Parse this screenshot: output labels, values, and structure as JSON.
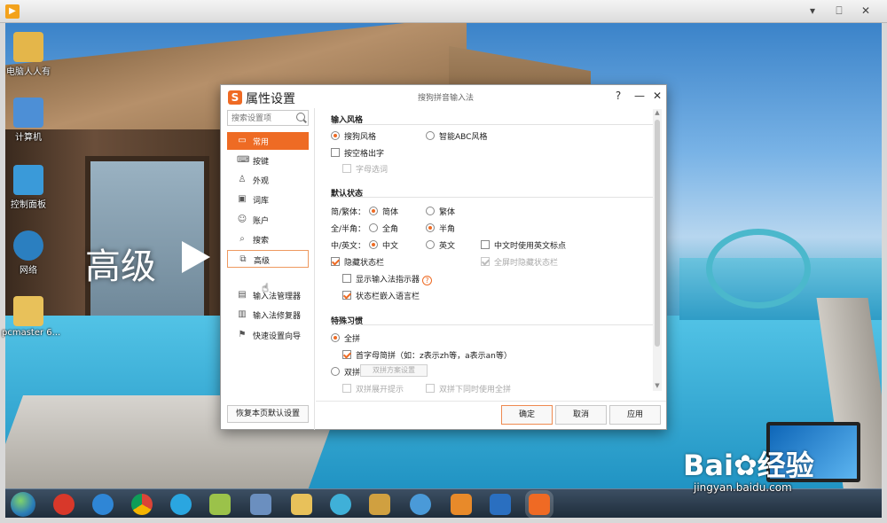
{
  "outer_window": {
    "minimize_glyph": "▾",
    "restore_glyph": "⎕",
    "close_glyph": "✕"
  },
  "desktop": {
    "icons": [
      {
        "name": "desktop-icon-diannao-renrenyou",
        "label": "电脑人人有",
        "color": "#e4b64a"
      },
      {
        "name": "desktop-icon-computer",
        "label": "计算机",
        "color": "#4d8fd6"
      },
      {
        "name": "desktop-icon-control-panel",
        "label": "控制面板",
        "color": "#3a9ad9"
      },
      {
        "name": "desktop-icon-network",
        "label": "网络",
        "color": "#2b7fc0"
      },
      {
        "name": "desktop-icon-pcmaster",
        "label": "pcmaster 6...",
        "color": "#e8c15a"
      }
    ],
    "overlay_text": "高级"
  },
  "dialog": {
    "title": "属性设置",
    "subtitle": "搜狗拼音输入法",
    "help_glyph": "?",
    "minimize_glyph": "—",
    "close_glyph": "✕",
    "search_placeholder": "搜索设置项",
    "nav": [
      {
        "label": "常用",
        "icon": "monitor-icon",
        "glyph": "▭"
      },
      {
        "label": "按键",
        "icon": "keyboard-icon",
        "glyph": "⌨"
      },
      {
        "label": "外观",
        "icon": "shirt-icon",
        "glyph": "♙"
      },
      {
        "label": "词库",
        "icon": "book-icon",
        "glyph": "▣"
      },
      {
        "label": "账户",
        "icon": "user-icon",
        "glyph": "☺"
      },
      {
        "label": "搜索",
        "icon": "search-icon",
        "glyph": "⌕"
      },
      {
        "label": "高级",
        "icon": "copy-icon",
        "glyph": "⧉"
      },
      {
        "label": "输入法管理器",
        "icon": "manager-icon",
        "glyph": "▤"
      },
      {
        "label": "输入法修复器",
        "icon": "toolbox-icon",
        "glyph": "▥"
      },
      {
        "label": "快速设置向导",
        "icon": "flag-icon",
        "glyph": "⚑"
      }
    ],
    "cursor_glyph": "☝",
    "restore_defaults": "恢复本页默认设置",
    "sections": {
      "input_style": {
        "title": "输入风格",
        "sogou_style": "搜狗风格",
        "abc_style": "智能ABC风格",
        "space_output": "按空格出字",
        "letter_select": "字母选词"
      },
      "default_state": {
        "title": "默认状态",
        "simp_trad_label": "简/繁体：",
        "simplified": "简体",
        "traditional": "繁体",
        "full_half_label": "全/半角：",
        "full_width": "全角",
        "half_width": "半角",
        "cn_en_label": "中/英文：",
        "chinese": "中文",
        "english": "英文",
        "en_punct_in_cn": "中文时使用英文标点",
        "hide_status_bar": "隐藏状态栏",
        "fullscreen_hide": "全屏时隐藏状态栏",
        "show_indicator": "显示输入法指示器",
        "help_glyph": "?",
        "embed_lang_bar": "状态栏嵌入语言栏"
      },
      "special_habits": {
        "title": "特殊习惯",
        "full_pinyin": "全拼",
        "initial_abbrev": "首字母简拼（如：z表示zh等，a表示an等）",
        "double_pinyin": "双拼",
        "double_scheme_btn": "双拼方案设置",
        "double_expand_hint": "双拼展开提示",
        "double_with_full": "双拼下同时使用全拼"
      }
    },
    "scroll_up_glyph": "▲",
    "scroll_down_glyph": "▼",
    "buttons": {
      "ok": "确定",
      "cancel": "取消",
      "apply": "应用"
    }
  },
  "taskbar": {
    "apps": [
      {
        "name": "taskbar-app-red-icon",
        "color": "#d8382a"
      },
      {
        "name": "taskbar-app-ie-icon",
        "color": "#2f86d6"
      },
      {
        "name": "taskbar-app-chrome-icon",
        "color": "#e0b32a"
      },
      {
        "name": "taskbar-app-blue-circle-icon",
        "color": "#2aa6e0"
      },
      {
        "name": "taskbar-app-notes-icon",
        "color": "#9bc24a"
      },
      {
        "name": "taskbar-app-qr-icon",
        "color": "#6b8fbf"
      },
      {
        "name": "taskbar-app-folder-icon",
        "color": "#e8c15a"
      },
      {
        "name": "taskbar-app-pinwheel-icon",
        "color": "#3fb0d8"
      },
      {
        "name": "taskbar-app-paint-icon",
        "color": "#d0a040"
      },
      {
        "name": "taskbar-app-dial-icon",
        "color": "#4a9ad8"
      },
      {
        "name": "taskbar-app-media-icon",
        "color": "#e88a2a"
      },
      {
        "name": "taskbar-app-office-icon",
        "color": "#2a6fc0"
      },
      {
        "name": "taskbar-app-sogou-icon",
        "color": "#ef6a24"
      }
    ]
  },
  "watermark": {
    "brand": "Bai",
    "brand_suffix": "经验",
    "url": "jingyan.baidu.com"
  },
  "colors": {
    "accent": "#ee6b24"
  }
}
